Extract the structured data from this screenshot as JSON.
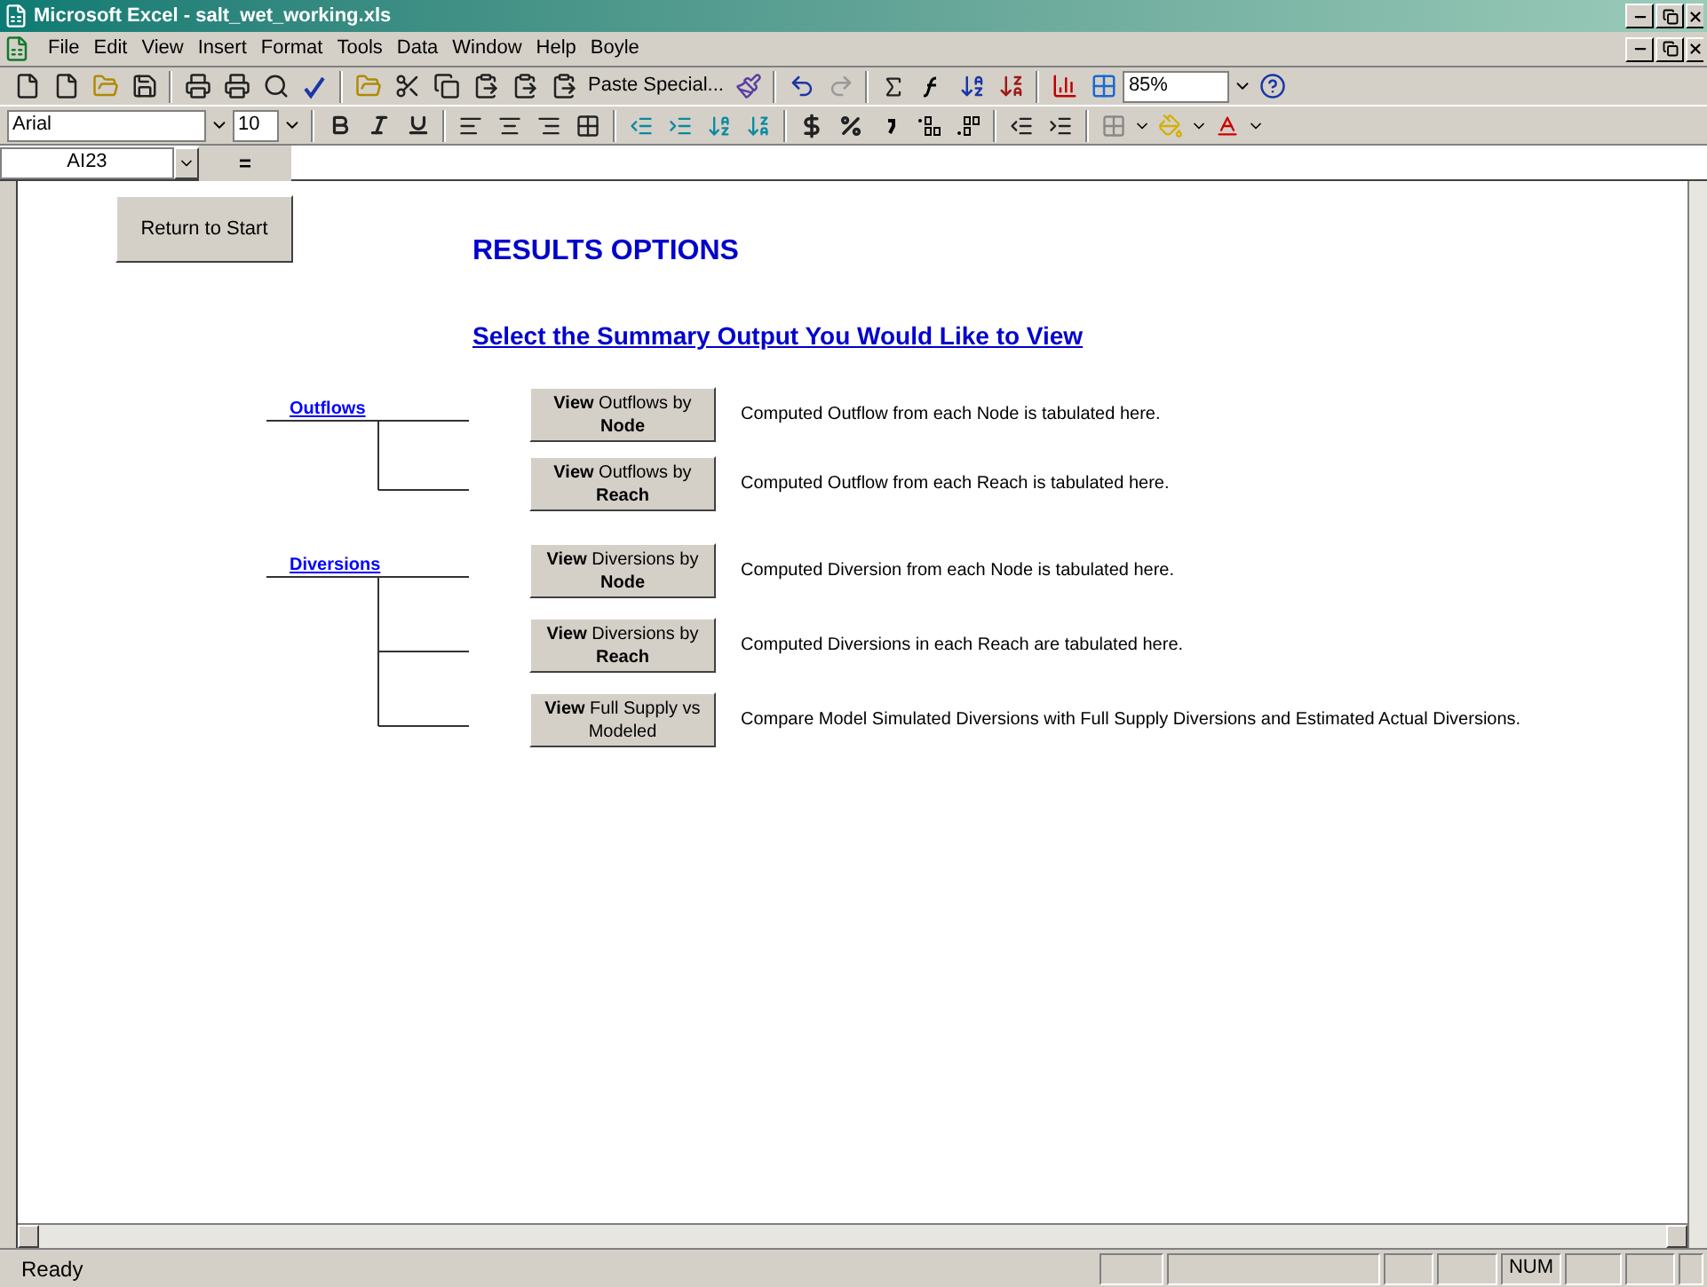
{
  "window": {
    "title": "Microsoft Excel - salt_wet_working.xls"
  },
  "menu": [
    "File",
    "Edit",
    "View",
    "Insert",
    "Format",
    "Tools",
    "Data",
    "Window",
    "Help",
    "Boyle"
  ],
  "standard_toolbar": {
    "paste_special": "Paste Special...",
    "zoom": "85%"
  },
  "formatting_toolbar": {
    "font": "Arial",
    "size": "10"
  },
  "formula_bar": {
    "name_box": "AI23",
    "equals": "="
  },
  "sheet": {
    "return_button": "Return to Start",
    "heading": "RESULTS OPTIONS",
    "subheading": "Select the Summary Output You Would Like to View",
    "groups": [
      {
        "label": "Outflows",
        "options": [
          {
            "lines": [
              "**View** Outflows by",
              "**Node**"
            ],
            "description": "Computed Outflow from each Node is tabulated here."
          },
          {
            "lines": [
              "**View**  Outflows by",
              "**Reach**"
            ],
            "description": "Computed Outflow from each Reach is tabulated here."
          }
        ]
      },
      {
        "label": "Diversions",
        "options": [
          {
            "lines": [
              "**View** Diversions by",
              "**Node**"
            ],
            "description": "Computed Diversion from each Node is tabulated here."
          },
          {
            "lines": [
              "**View** Diversions by",
              "**Reach**"
            ],
            "description": "Computed Diversions in each Reach are tabulated here."
          },
          {
            "lines": [
              "**View** Full Supply vs",
              "Modeled"
            ],
            "description": "Compare Model Simulated Diversions with Full Supply Diversions and Estimated Actual Diversions."
          }
        ]
      }
    ]
  },
  "status_bar": {
    "status": "Ready",
    "num": "NUM"
  }
}
